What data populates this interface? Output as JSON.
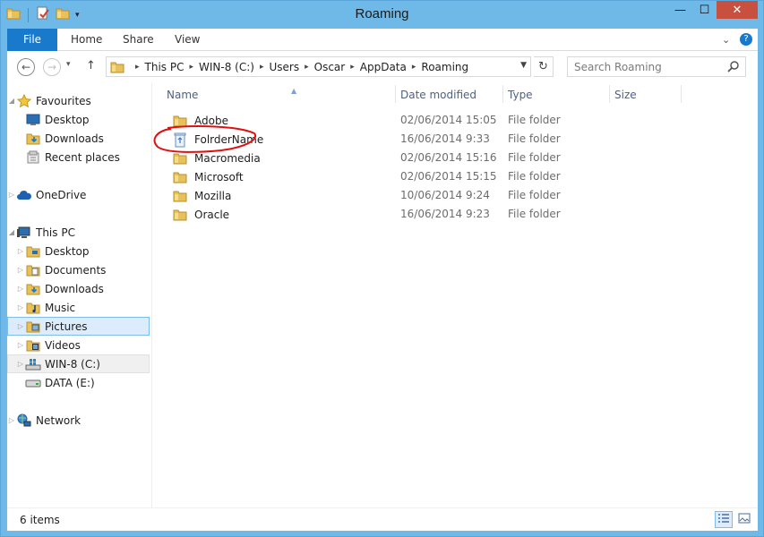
{
  "window": {
    "title": "Roaming",
    "buttons": {
      "minimize": "—",
      "maximize": "☐",
      "close": "✕"
    }
  },
  "ribbon": {
    "tabs": [
      "File",
      "Home",
      "Share",
      "View"
    ],
    "collapse_glyph": "⌄",
    "help_glyph": "?"
  },
  "address": {
    "crumbs": [
      "This PC",
      "WIN-8 (C:)",
      "Users",
      "Oscar",
      "AppData",
      "Roaming"
    ],
    "search_placeholder": "Search Roaming"
  },
  "nav": {
    "favourites": {
      "label": "Favourites",
      "items": [
        "Desktop",
        "Downloads",
        "Recent places"
      ]
    },
    "onedrive": "OneDrive",
    "thispc": {
      "label": "This PC",
      "items": [
        "Desktop",
        "Documents",
        "Downloads",
        "Music",
        "Pictures",
        "Videos",
        "WIN-8 (C:)",
        "DATA (E:)"
      ]
    },
    "network": "Network"
  },
  "columns": {
    "name": "Name",
    "date": "Date modified",
    "type": "Type",
    "size": "Size"
  },
  "files": [
    {
      "name": "Adobe",
      "date": "02/06/2014 15:05",
      "type": "File folder",
      "icon": "folder-icon"
    },
    {
      "name": "FolrderName",
      "date": "16/06/2014 9:33",
      "type": "File folder",
      "icon": "recycle-bin-folder-icon"
    },
    {
      "name": "Macromedia",
      "date": "02/06/2014 15:16",
      "type": "File folder",
      "icon": "folder-icon"
    },
    {
      "name": "Microsoft",
      "date": "02/06/2014 15:15",
      "type": "File folder",
      "icon": "folder-icon"
    },
    {
      "name": "Mozilla",
      "date": "10/06/2014 9:24",
      "type": "File folder",
      "icon": "folder-icon"
    },
    {
      "name": "Oracle",
      "date": "16/06/2014 9:23",
      "type": "File folder",
      "icon": "folder-icon"
    }
  ],
  "status": {
    "item_count": "6 items"
  },
  "colors": {
    "accent": "#1979ca",
    "chrome": "#6fb9e8",
    "close": "#c7503f",
    "annotation": "#e01010",
    "folder": "#e8c15a"
  }
}
